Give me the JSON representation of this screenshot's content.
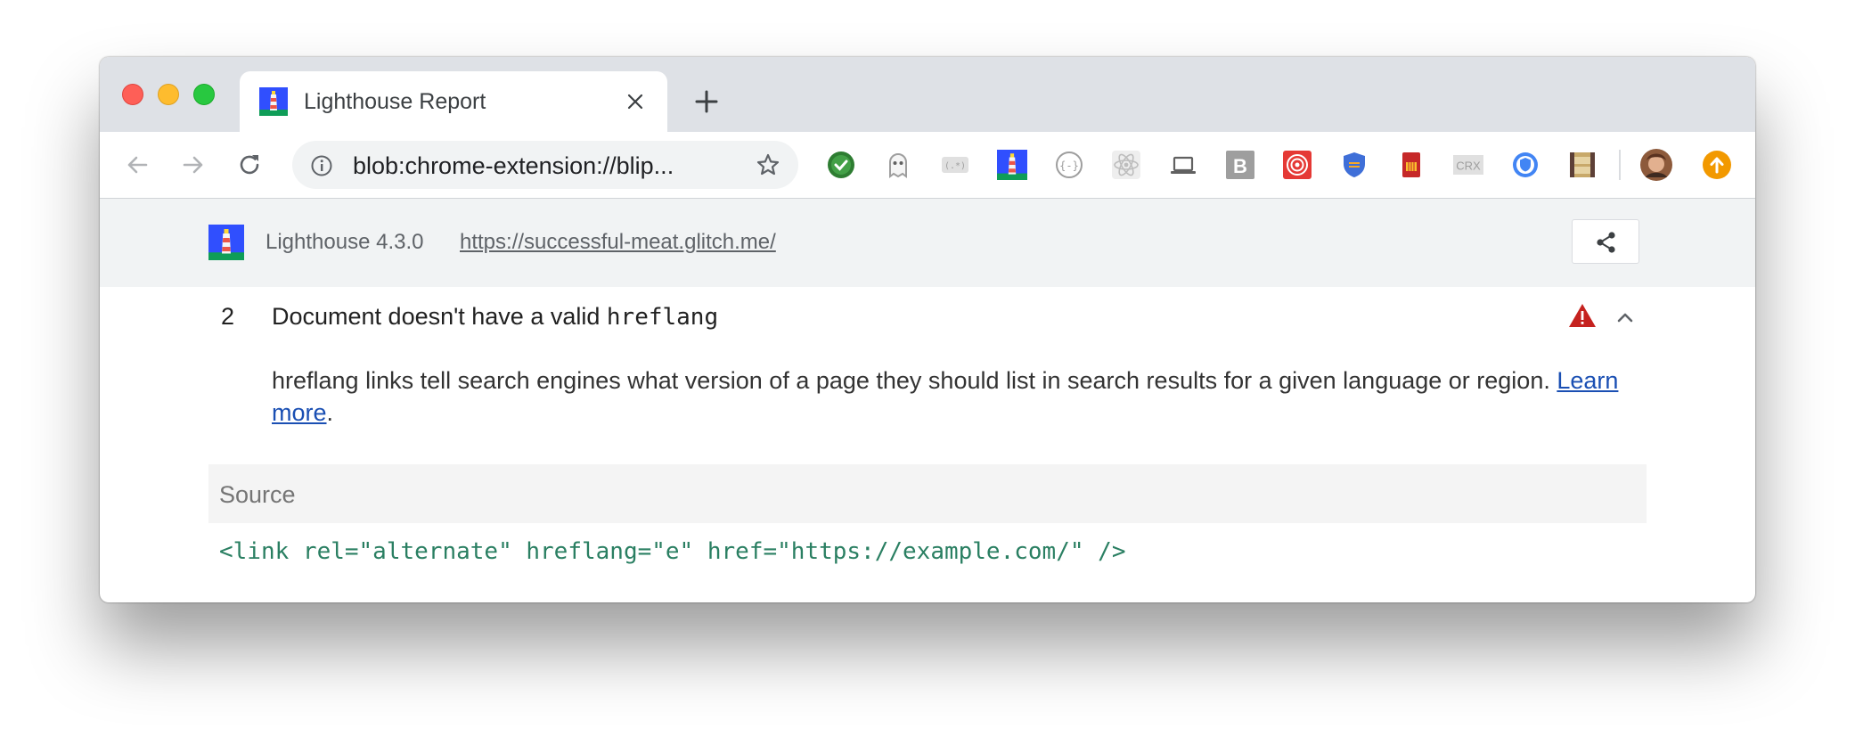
{
  "browser": {
    "tab": {
      "title": "Lighthouse Report",
      "favicon": "lighthouse-icon"
    },
    "omnibox": {
      "url": "blob:chrome-extension://blip..."
    },
    "extensions": [
      "checkmark-ext-icon",
      "ghost-ext-icon",
      "regex-ext-icon",
      "lighthouse-ext-icon",
      "json-ext-icon",
      "react-ext-icon",
      "laptop-ext-icon",
      "b-ext-icon",
      "target-ext-icon",
      "shield-ext-icon",
      "card-ext-icon",
      "crx-ext-icon",
      "globe-shield-ext-icon",
      "film-ext-icon",
      "avatar-icon",
      "update-icon"
    ],
    "crx_label": "CRX",
    "b_label": "B"
  },
  "header": {
    "version": "Lighthouse 4.3.0",
    "url": "https://successful-meat.glitch.me/"
  },
  "audit": {
    "index": "2",
    "title_prefix": "Document doesn't have a valid ",
    "title_code": "hreflang",
    "description": "hreflang links tell search engines what version of a page they should list in search results for a given language or region.",
    "learn_more": "Learn more",
    "learn_more_suffix": ".",
    "status_color": "#c5221f"
  },
  "details": {
    "column_header": "Source",
    "rows": [
      "<link rel=\"alternate\" hreflang=\"e\" href=\"https://example.com/\" />"
    ]
  }
}
